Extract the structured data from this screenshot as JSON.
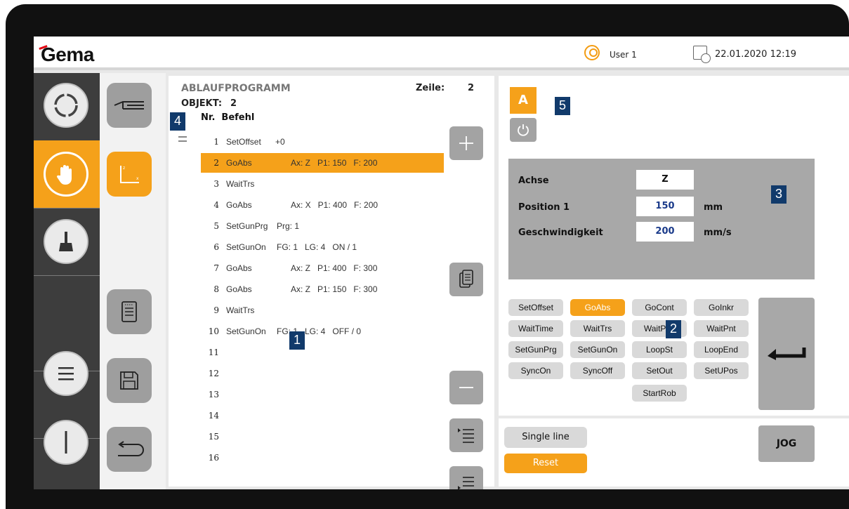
{
  "header": {
    "logo": "Gema",
    "user": "User 1",
    "datetime": "22.01.2020 12:19"
  },
  "program": {
    "title": "ABLAUFPROGRAMM",
    "zeile_label": "Zeile:",
    "zeile_value": "2",
    "objekt_label": "OBJEKT:",
    "objekt_value": "2",
    "col_header": "Nr.  Befehl",
    "rows": [
      {
        "num": "1",
        "cmd": "SetOffset",
        "params": "+0"
      },
      {
        "num": "2",
        "cmd": "GoAbs",
        "params": "Ax: Z   P1: 150   F: 200"
      },
      {
        "num": "3",
        "cmd": "WaitTrs",
        "params": ""
      },
      {
        "num": "4",
        "cmd": "GoAbs",
        "params": "Ax: X   P1: 400   F: 200"
      },
      {
        "num": "5",
        "cmd": "SetGunPrg",
        "params": "Prg: 1"
      },
      {
        "num": "6",
        "cmd": "SetGunOn",
        "params": "FG: 1   LG: 4   ON / 1"
      },
      {
        "num": "7",
        "cmd": "GoAbs",
        "params": "Ax: Z   P1: 400   F: 300"
      },
      {
        "num": "8",
        "cmd": "GoAbs",
        "params": "Ax: Z   P1: 150   F: 300"
      },
      {
        "num": "9",
        "cmd": "WaitTrs",
        "params": ""
      },
      {
        "num": "10",
        "cmd": "SetGunOn",
        "params": "FG: 1   LG: 4   OFF / 0"
      },
      {
        "num": "11",
        "cmd": "",
        "params": ""
      },
      {
        "num": "12",
        "cmd": "",
        "params": ""
      },
      {
        "num": "13",
        "cmd": "",
        "params": ""
      },
      {
        "num": "14",
        "cmd": "",
        "params": ""
      },
      {
        "num": "15",
        "cmd": "",
        "params": ""
      },
      {
        "num": "16",
        "cmd": "",
        "params": ""
      }
    ],
    "selected_row": 2
  },
  "params": {
    "achse_label": "Achse",
    "achse_value": "Z",
    "position_label": "Position 1",
    "position_value": "150",
    "position_unit": "mm",
    "speed_label": "Geschwindigkeit",
    "speed_value": "200",
    "speed_unit": "mm/s"
  },
  "mode": {
    "a_label": "A"
  },
  "commands": [
    [
      "SetOffset",
      "GoAbs",
      "GoCont",
      "GoInkr"
    ],
    [
      "WaitTime",
      "WaitTrs",
      "WaitPos",
      "WaitPnt"
    ],
    [
      "SetGunPrg",
      "SetGunOn",
      "LoopSt",
      "LoopEnd"
    ],
    [
      "SyncOn",
      "SyncOff",
      "SetOut",
      "SetUPos"
    ],
    [
      "",
      "",
      "StartRob",
      ""
    ]
  ],
  "bottom": {
    "single_line": "Single line",
    "reset": "Reset",
    "jog": "JOG"
  },
  "badges": {
    "b1": "1",
    "b2": "2",
    "b3": "3",
    "b4": "4",
    "b5": "5"
  },
  "colors": {
    "accent": "#f5a11a",
    "badge": "#113a6b",
    "sidebar": "#3d3d3d"
  }
}
